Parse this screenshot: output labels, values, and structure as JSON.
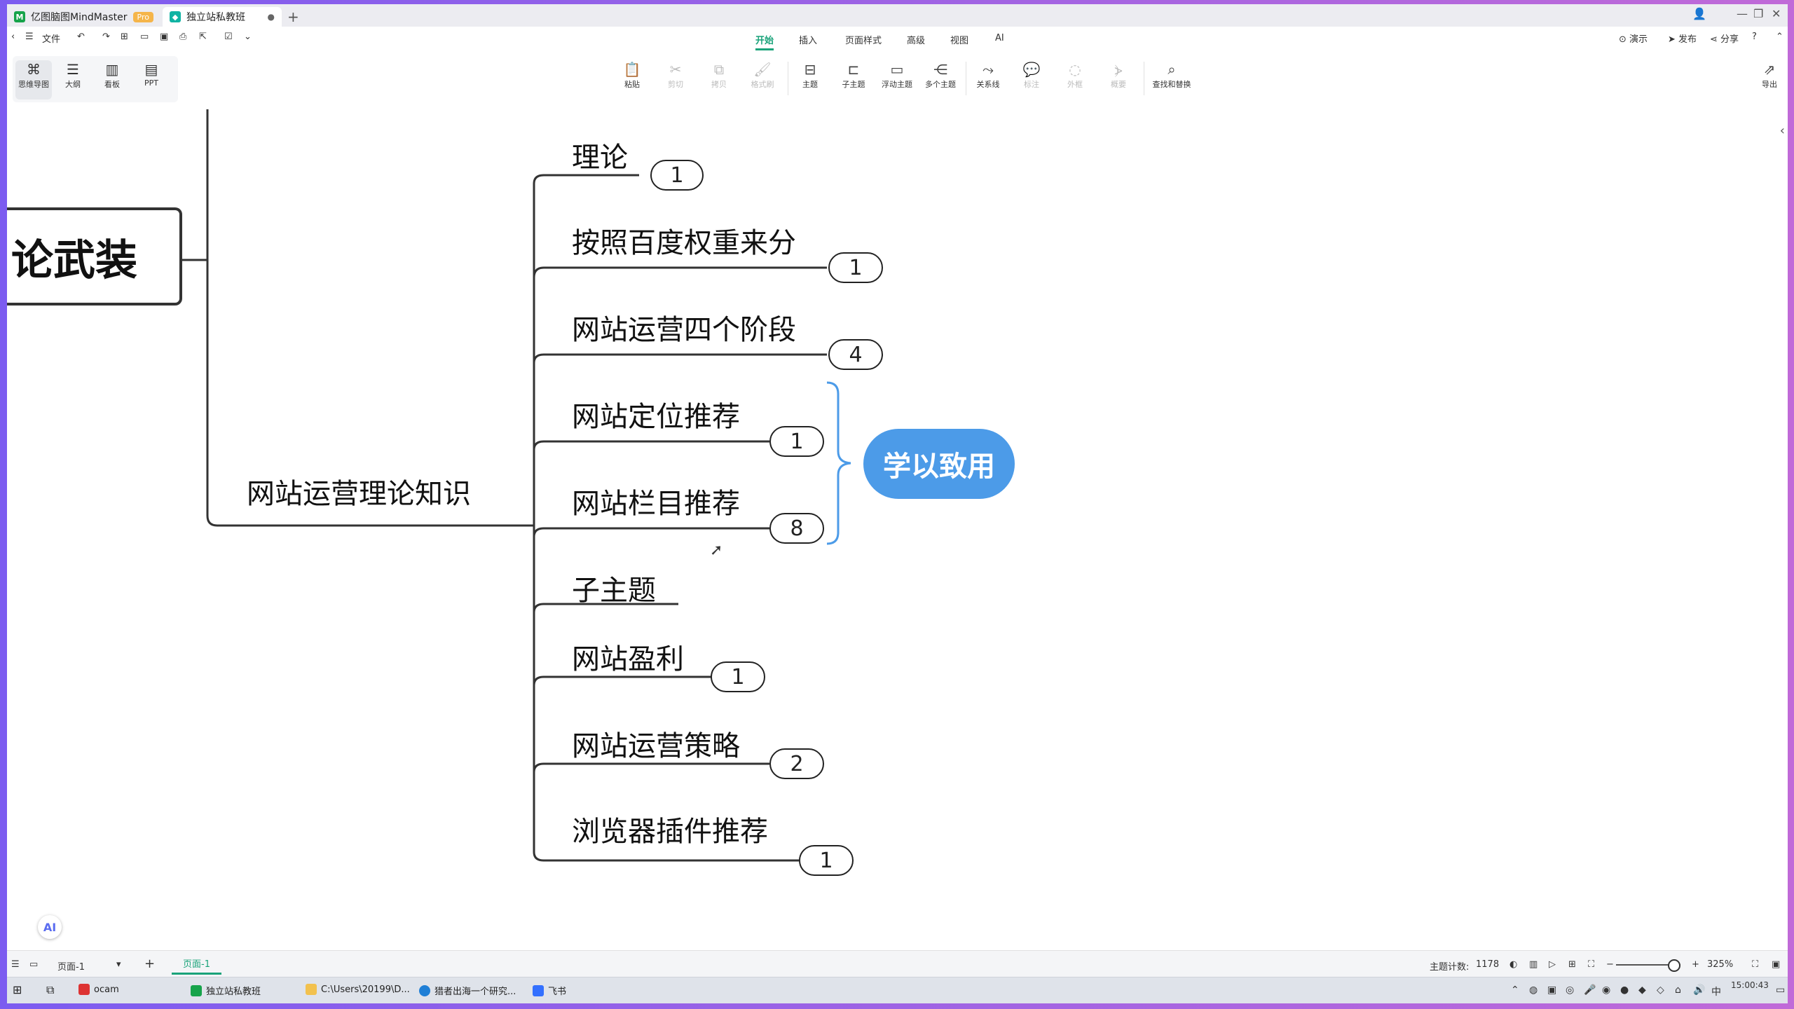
{
  "titlebar": {
    "tab1_title": "亿图脑图MindMaster",
    "tab1_badge": "Pro",
    "tab2_title": "独立站私教班",
    "tab2_close": "●",
    "new_tab": "+",
    "controls": [
      "—",
      "❐",
      "✕"
    ]
  },
  "menu": {
    "file_label": "文件",
    "tabs": [
      "开始",
      "插入",
      "页面样式",
      "高级",
      "视图",
      "AI"
    ],
    "active_tab": "开始",
    "right": {
      "present": "演示",
      "publish": "发布",
      "share": "分享"
    }
  },
  "ribbon": {
    "views": [
      "思维导图",
      "大纲",
      "看板",
      "PPT"
    ],
    "tools": [
      "粘贴",
      "剪切",
      "拷贝",
      "格式刷",
      "主题",
      "子主题",
      "浮动主题",
      "多个主题",
      "关系线",
      "标注",
      "外框",
      "概要",
      "查找和替换"
    ],
    "export": "导出"
  },
  "mindmap": {
    "root_text": "论武装",
    "branch_text": "网站运营理论知识",
    "topics": [
      {
        "text": "理论",
        "count": "1"
      },
      {
        "text": "按照百度权重来分",
        "count": "1"
      },
      {
        "text": "网站运营四个阶段",
        "count": "4"
      },
      {
        "text": "网站定位推荐",
        "count": "1"
      },
      {
        "text": "网站栏目推荐",
        "count": "8"
      },
      {
        "text": "子主题",
        "count": ""
      },
      {
        "text": "网站盈利",
        "count": "1"
      },
      {
        "text": "网站运营策略",
        "count": "2"
      },
      {
        "text": "浏览器插件推荐",
        "count": "1"
      }
    ],
    "summary_text": "学以致用",
    "colors": {
      "summary": "#4c9be8",
      "accent": "#1aa37a",
      "line": "#333333"
    }
  },
  "statusbar": {
    "page_select": "页面-1",
    "page_tab": "页面-1",
    "topic_count_label": "主题计数:",
    "topic_count": "1178",
    "zoom": "325%"
  },
  "taskbar": {
    "items": [
      "ocam",
      "独立站私教班",
      "C:\\Users\\20199\\D...",
      "猎者出海一个研究...",
      "飞书"
    ],
    "time": "15:00:43"
  }
}
